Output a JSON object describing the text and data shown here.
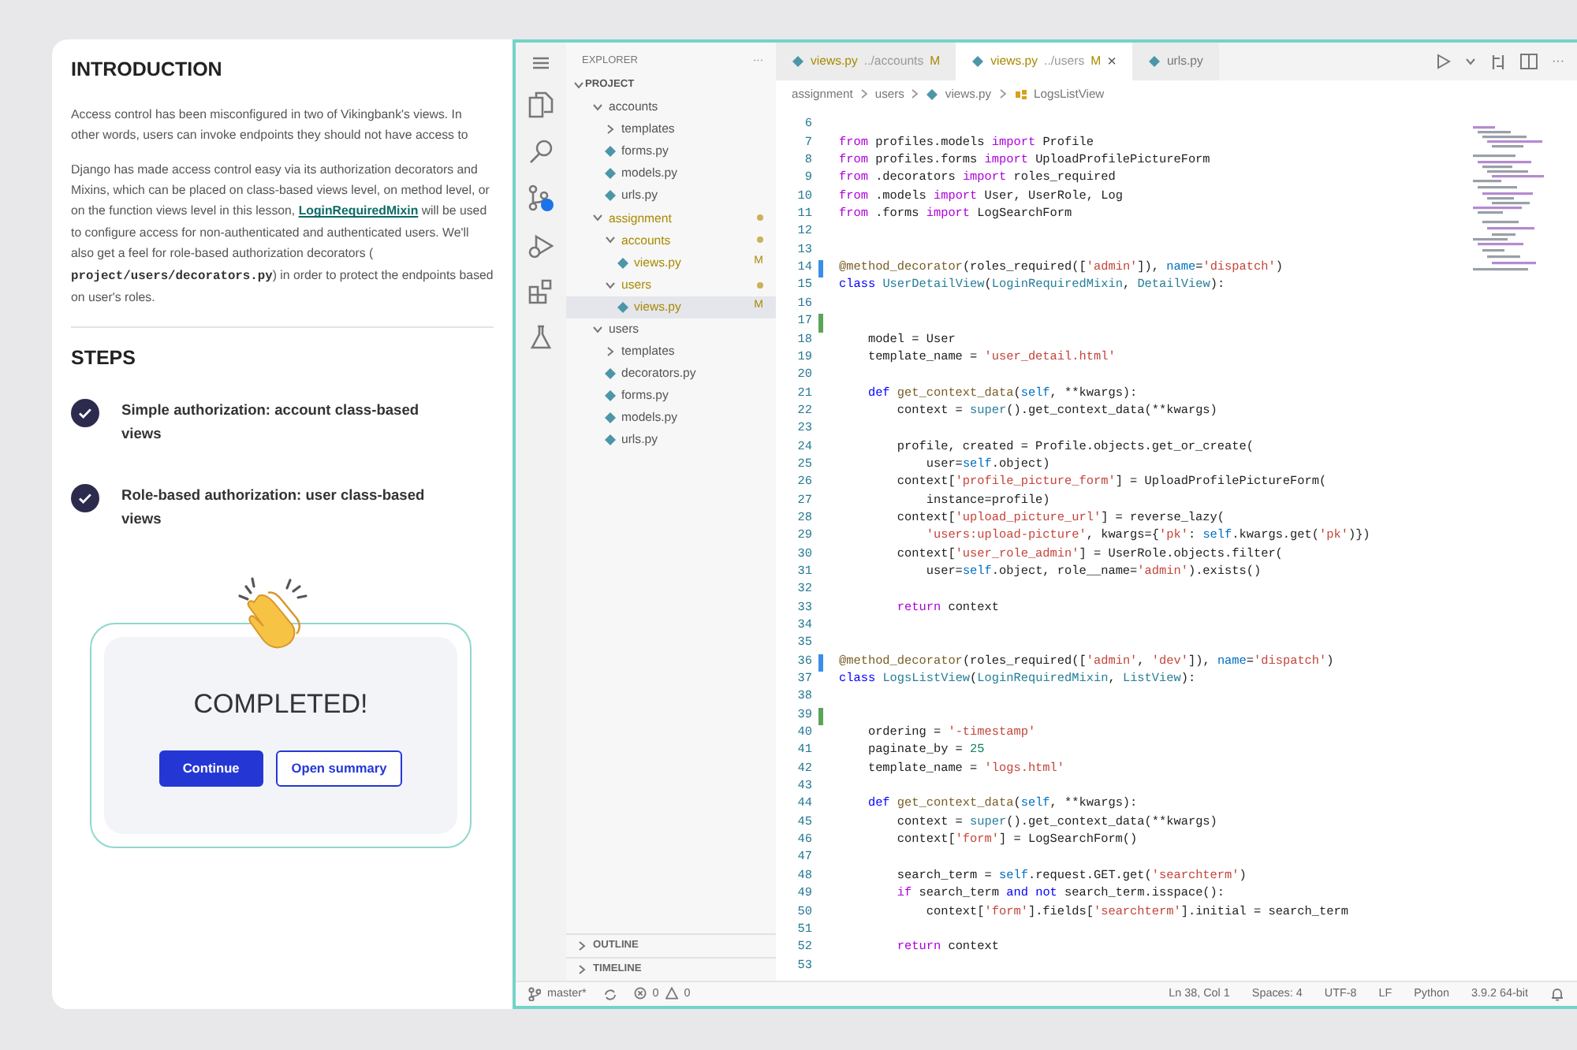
{
  "lesson": {
    "intro_title": "INTRODUCTION",
    "paragraph_1": "Access control has been misconfigured in two of Vikingbank's views. In other words, users can invoke endpoints they should not have access to",
    "paragraph_2": {
      "before": "Django has made access control easy via its authorization decorators and Mixins, which can be placed on class-based views level, on method level, or on the function views level in this lesson, ",
      "link": "LoginRequiredMixin",
      "middle": " will be used to configure access for non-authenticated and authenticated users. We'll also get a feel for role-based authorization decorators ( ",
      "code": "project/users/decorators.py",
      "after": ") in order to protect the endpoints based on user's roles."
    },
    "steps_title": "STEPS",
    "steps": [
      {
        "label": "Simple authorization: account class-based views",
        "done": true
      },
      {
        "label": "Role-based authorization: user class-based views",
        "done": true
      }
    ],
    "completed": {
      "title": "COMPLETED!",
      "buttons": [
        {
          "label": "Continue",
          "kind": "primary"
        },
        {
          "label": "Open summary",
          "kind": "outline"
        }
      ]
    }
  },
  "explorer": {
    "title": "EXPLORER",
    "more": "···",
    "root": "PROJECT",
    "tree": [
      {
        "label": "accounts",
        "kind": "folder",
        "expanded": true,
        "modified": false,
        "selected": false,
        "children": [
          {
            "label": "templates",
            "kind": "folder",
            "expanded": false,
            "modified": false,
            "selected": false
          },
          {
            "label": "forms.py",
            "kind": "file",
            "modified": false,
            "selected": false
          },
          {
            "label": "models.py",
            "kind": "file",
            "modified": false,
            "selected": false
          },
          {
            "label": "urls.py",
            "kind": "file",
            "modified": false,
            "selected": false
          }
        ]
      },
      {
        "label": "assignment",
        "kind": "folder",
        "expanded": true,
        "modified": true,
        "selected": false,
        "children": [
          {
            "label": "accounts",
            "kind": "folder",
            "expanded": true,
            "modified": true,
            "selected": false,
            "children": [
              {
                "label": "views.py",
                "kind": "file",
                "modified": true,
                "status": "M",
                "selected": false
              }
            ]
          },
          {
            "label": "users",
            "kind": "folder",
            "expanded": true,
            "modified": true,
            "selected": false,
            "children": [
              {
                "label": "views.py",
                "kind": "file",
                "modified": true,
                "status": "M",
                "selected": true
              }
            ]
          }
        ]
      },
      {
        "label": "users",
        "kind": "folder",
        "expanded": true,
        "modified": false,
        "selected": false,
        "children": [
          {
            "label": "templates",
            "kind": "folder",
            "expanded": false,
            "modified": false,
            "selected": false
          },
          {
            "label": "decorators.py",
            "kind": "file",
            "modified": false,
            "selected": false
          },
          {
            "label": "forms.py",
            "kind": "file",
            "modified": false,
            "selected": false
          },
          {
            "label": "models.py",
            "kind": "file",
            "modified": false,
            "selected": false
          },
          {
            "label": "urls.py",
            "kind": "file",
            "modified": false,
            "selected": false
          }
        ]
      }
    ],
    "sections": [
      {
        "label": "OUTLINE",
        "expanded": false
      },
      {
        "label": "TIMELINE",
        "expanded": false
      }
    ]
  },
  "tabs": [
    {
      "label": "views.py",
      "description": "../accounts",
      "status": "M",
      "selected": false
    },
    {
      "label": "views.py",
      "description": "../users",
      "status": "M",
      "selected": true,
      "close": "×"
    },
    {
      "label": "urls.py",
      "selected": false
    }
  ],
  "editor_more": "···",
  "breadcrumb": [
    "assignment",
    "users",
    "views.py",
    "LogsListView"
  ],
  "code": [
    {
      "n": "6"
    },
    {
      "n": "7",
      "tokens": [
        {
          "kind": "kw",
          "text": "from"
        },
        {
          "kind": "plain",
          "text": " profiles.models "
        },
        {
          "kind": "kw",
          "text": "import"
        },
        {
          "kind": "plain",
          "text": " Profile"
        }
      ]
    },
    {
      "n": "8",
      "tokens": [
        {
          "kind": "kw",
          "text": "from"
        },
        {
          "kind": "plain",
          "text": " profiles.forms "
        },
        {
          "kind": "kw",
          "text": "import"
        },
        {
          "kind": "plain",
          "text": " UploadProfilePictureForm"
        }
      ]
    },
    {
      "n": "9",
      "tokens": [
        {
          "kind": "kw",
          "text": "from"
        },
        {
          "kind": "plain",
          "text": " .decorators "
        },
        {
          "kind": "kw",
          "text": "import"
        },
        {
          "kind": "plain",
          "text": " roles_required"
        }
      ]
    },
    {
      "n": "10",
      "tokens": [
        {
          "kind": "kw",
          "text": "from"
        },
        {
          "kind": "plain",
          "text": " .models "
        },
        {
          "kind": "kw",
          "text": "import"
        },
        {
          "kind": "plain",
          "text": " User, UserRole, Log"
        }
      ]
    },
    {
      "n": "11",
      "tokens": [
        {
          "kind": "kw",
          "text": "from"
        },
        {
          "kind": "plain",
          "text": " .forms "
        },
        {
          "kind": "kw",
          "text": "import"
        },
        {
          "kind": "plain",
          "text": " LogSearchForm"
        }
      ]
    },
    {
      "n": "12"
    },
    {
      "n": "13"
    },
    {
      "n": "14",
      "color": "#3b8ee8",
      "tokens": [
        {
          "kind": "func",
          "text": "@method_decorator"
        },
        {
          "kind": "plain",
          "text": "(roles_required(["
        },
        {
          "kind": "str",
          "text": "'admin'"
        },
        {
          "kind": "plain",
          "text": "]), "
        },
        {
          "kind": "var",
          "text": "name"
        },
        {
          "kind": "plain",
          "text": "="
        },
        {
          "kind": "str",
          "text": "'dispatch'"
        },
        {
          "kind": "plain",
          "text": ")"
        }
      ]
    },
    {
      "n": "15",
      "tokens": [
        {
          "kind": "decl",
          "text": "class "
        },
        {
          "kind": "cls",
          "text": "UserDetailView"
        },
        {
          "kind": "plain",
          "text": "("
        },
        {
          "kind": "cls",
          "text": "LoginRequiredMixin"
        },
        {
          "kind": "plain",
          "text": ", "
        },
        {
          "kind": "cls",
          "text": "DetailView"
        },
        {
          "kind": "plain",
          "text": "):"
        }
      ]
    },
    {
      "n": "16"
    },
    {
      "n": "17",
      "color": "#5aa55a"
    },
    {
      "n": "18",
      "tokens": [
        {
          "kind": "plain",
          "text": "    model = User"
        }
      ]
    },
    {
      "n": "19",
      "tokens": [
        {
          "kind": "plain",
          "text": "    template_name = "
        },
        {
          "kind": "str",
          "text": "'user_detail.html'"
        }
      ]
    },
    {
      "n": "20"
    },
    {
      "n": "21",
      "tokens": [
        {
          "kind": "decl",
          "text": "    def "
        },
        {
          "kind": "func",
          "text": "get_context_data"
        },
        {
          "kind": "plain",
          "text": "("
        },
        {
          "kind": "var",
          "text": "self"
        },
        {
          "kind": "plain",
          "text": ", **kwargs):"
        }
      ]
    },
    {
      "n": "22",
      "tokens": [
        {
          "kind": "plain",
          "text": "        context = "
        },
        {
          "kind": "cls",
          "text": "super"
        },
        {
          "kind": "plain",
          "text": "().get_context_data(**kwargs)"
        }
      ]
    },
    {
      "n": "23"
    },
    {
      "n": "24",
      "tokens": [
        {
          "kind": "plain",
          "text": "        profile, created = Profile.objects.get_or_create("
        }
      ]
    },
    {
      "n": "25",
      "tokens": [
        {
          "kind": "plain",
          "text": "            user="
        },
        {
          "kind": "var",
          "text": "self"
        },
        {
          "kind": "plain",
          "text": ".object)"
        }
      ]
    },
    {
      "n": "26",
      "tokens": [
        {
          "kind": "plain",
          "text": "        context["
        },
        {
          "kind": "str",
          "text": "'profile_picture_form'"
        },
        {
          "kind": "plain",
          "text": "] = UploadProfilePictureForm("
        }
      ]
    },
    {
      "n": "27",
      "tokens": [
        {
          "kind": "plain",
          "text": "            instance=profile)"
        }
      ]
    },
    {
      "n": "28",
      "tokens": [
        {
          "kind": "plain",
          "text": "        context["
        },
        {
          "kind": "str",
          "text": "'upload_picture_url'"
        },
        {
          "kind": "plain",
          "text": "] = reverse_lazy("
        }
      ]
    },
    {
      "n": "29",
      "tokens": [
        {
          "kind": "str",
          "text": "            'users:upload-picture'"
        },
        {
          "kind": "plain",
          "text": ", kwargs={"
        },
        {
          "kind": "str",
          "text": "'pk'"
        },
        {
          "kind": "plain",
          "text": ": "
        },
        {
          "kind": "var",
          "text": "self"
        },
        {
          "kind": "plain",
          "text": ".kwargs.get("
        },
        {
          "kind": "str",
          "text": "'pk'"
        },
        {
          "kind": "plain",
          "text": ")})"
        }
      ]
    },
    {
      "n": "30",
      "tokens": [
        {
          "kind": "plain",
          "text": "        context["
        },
        {
          "kind": "str",
          "text": "'user_role_admin'"
        },
        {
          "kind": "plain",
          "text": "] = UserRole.objects.filter("
        }
      ]
    },
    {
      "n": "31",
      "tokens": [
        {
          "kind": "plain",
          "text": "            user="
        },
        {
          "kind": "var",
          "text": "self"
        },
        {
          "kind": "plain",
          "text": ".object, role__name="
        },
        {
          "kind": "str",
          "text": "'admin'"
        },
        {
          "kind": "plain",
          "text": ").exists()"
        }
      ]
    },
    {
      "n": "32"
    },
    {
      "n": "33",
      "tokens": [
        {
          "kind": "kw",
          "text": "        return"
        },
        {
          "kind": "plain",
          "text": " context"
        }
      ]
    },
    {
      "n": "34"
    },
    {
      "n": "35"
    },
    {
      "n": "36",
      "color": "#3b8ee8",
      "tokens": [
        {
          "kind": "func",
          "text": "@method_decorator"
        },
        {
          "kind": "plain",
          "text": "(roles_required(["
        },
        {
          "kind": "str",
          "text": "'admin'"
        },
        {
          "kind": "plain",
          "text": ", "
        },
        {
          "kind": "str",
          "text": "'dev'"
        },
        {
          "kind": "plain",
          "text": "]), "
        },
        {
          "kind": "var",
          "text": "name"
        },
        {
          "kind": "plain",
          "text": "="
        },
        {
          "kind": "str",
          "text": "'dispatch'"
        },
        {
          "kind": "plain",
          "text": ")"
        }
      ]
    },
    {
      "n": "37",
      "tokens": [
        {
          "kind": "decl",
          "text": "class "
        },
        {
          "kind": "cls",
          "text": "LogsListView"
        },
        {
          "kind": "plain",
          "text": "("
        },
        {
          "kind": "cls",
          "text": "LoginRequiredMixin"
        },
        {
          "kind": "plain",
          "text": ", "
        },
        {
          "kind": "cls",
          "text": "ListView"
        },
        {
          "kind": "plain",
          "text": "):"
        }
      ]
    },
    {
      "n": "38"
    },
    {
      "n": "39",
      "color": "#5aa55a"
    },
    {
      "n": "40",
      "tokens": [
        {
          "kind": "plain",
          "text": "    ordering = "
        },
        {
          "kind": "str",
          "text": "'-timestamp'"
        }
      ]
    },
    {
      "n": "41",
      "tokens": [
        {
          "kind": "plain",
          "text": "    paginate_by = "
        },
        {
          "kind": "num",
          "text": "25"
        }
      ]
    },
    {
      "n": "42",
      "tokens": [
        {
          "kind": "plain",
          "text": "    template_name = "
        },
        {
          "kind": "str",
          "text": "'logs.html'"
        }
      ]
    },
    {
      "n": "43"
    },
    {
      "n": "44",
      "tokens": [
        {
          "kind": "decl",
          "text": "    def "
        },
        {
          "kind": "func",
          "text": "get_context_data"
        },
        {
          "kind": "plain",
          "text": "("
        },
        {
          "kind": "var",
          "text": "self"
        },
        {
          "kind": "plain",
          "text": ", **kwargs):"
        }
      ]
    },
    {
      "n": "45",
      "tokens": [
        {
          "kind": "plain",
          "text": "        context = "
        },
        {
          "kind": "cls",
          "text": "super"
        },
        {
          "kind": "plain",
          "text": "().get_context_data(**kwargs)"
        }
      ]
    },
    {
      "n": "46",
      "tokens": [
        {
          "kind": "plain",
          "text": "        context["
        },
        {
          "kind": "str",
          "text": "'form'"
        },
        {
          "kind": "plain",
          "text": "] = LogSearchForm()"
        }
      ]
    },
    {
      "n": "47"
    },
    {
      "n": "48",
      "tokens": [
        {
          "kind": "plain",
          "text": "        search_term = "
        },
        {
          "kind": "var",
          "text": "self"
        },
        {
          "kind": "plain",
          "text": ".request.GET.get("
        },
        {
          "kind": "str",
          "text": "'searchterm'"
        },
        {
          "kind": "plain",
          "text": ")"
        }
      ]
    },
    {
      "n": "49",
      "tokens": [
        {
          "kind": "kw",
          "text": "        if"
        },
        {
          "kind": "plain",
          "text": " search_term "
        },
        {
          "kind": "decl",
          "text": "and not"
        },
        {
          "kind": "plain",
          "text": " search_term.isspace():"
        }
      ]
    },
    {
      "n": "50",
      "tokens": [
        {
          "kind": "plain",
          "text": "            context["
        },
        {
          "kind": "str",
          "text": "'form'"
        },
        {
          "kind": "plain",
          "text": "].fields["
        },
        {
          "kind": "str",
          "text": "'searchterm'"
        },
        {
          "kind": "plain",
          "text": "].initial = search_term"
        }
      ]
    },
    {
      "n": "51"
    },
    {
      "n": "52",
      "tokens": [
        {
          "kind": "kw",
          "text": "        return"
        },
        {
          "kind": "plain",
          "text": " context"
        }
      ]
    },
    {
      "n": "53"
    }
  ],
  "status_bar": {
    "branch": "master*",
    "errors": "0",
    "warnings": "0",
    "right": [
      "Ln 38, Col 1",
      "Spaces: 4",
      "UTF-8",
      "LF",
      "Python",
      "3.9.2 64-bit"
    ]
  }
}
